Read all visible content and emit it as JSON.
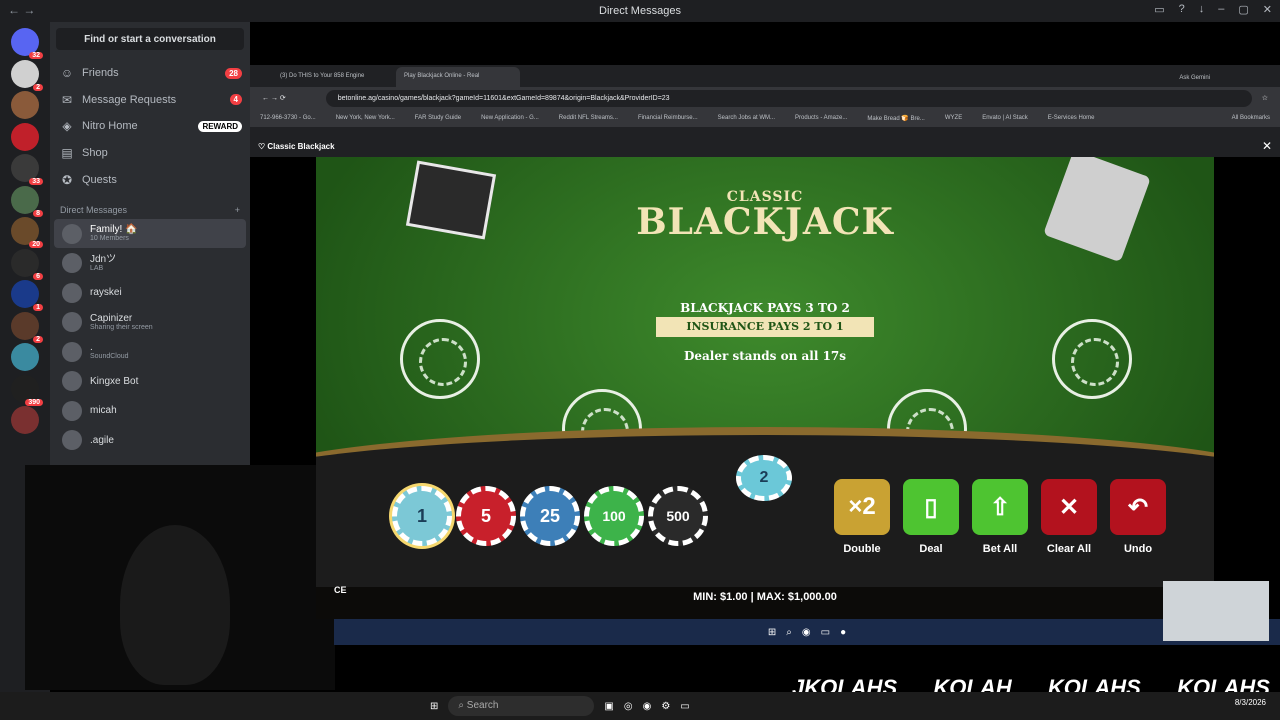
{
  "window": {
    "title": "Direct Messages"
  },
  "servers": [
    {
      "badge": "32"
    },
    {
      "badge": "2"
    },
    {
      "badge": ""
    },
    {
      "badge": ""
    },
    {
      "badge": "33"
    },
    {
      "badge": "8"
    },
    {
      "badge": "20"
    },
    {
      "badge": "6"
    },
    {
      "badge": "1"
    },
    {
      "badge": "2"
    },
    {
      "badge": ""
    },
    {
      "badge": "390"
    },
    {
      "badge": ""
    }
  ],
  "dmpanel": {
    "search": "Find or start a conversation",
    "nav": [
      {
        "label": "Friends",
        "badge": "28"
      },
      {
        "label": "Message Requests",
        "badge": "4"
      },
      {
        "label": "Nitro Home",
        "badge": "REWARD"
      },
      {
        "label": "Shop",
        "badge": ""
      },
      {
        "label": "Quests",
        "badge": ""
      }
    ],
    "header": "Direct Messages",
    "dms": [
      {
        "name": "Family! 🏠",
        "sub": "10 Members"
      },
      {
        "name": "Jdnツ",
        "sub": "LAB"
      },
      {
        "name": "rayskei",
        "sub": ""
      },
      {
        "name": "Capinizer",
        "sub": "Sharing their screen"
      },
      {
        "name": ".",
        "sub": "SoundCloud"
      },
      {
        "name": "Kingxe Bot",
        "sub": ""
      },
      {
        "name": "micah",
        "sub": ""
      },
      {
        "name": ".agile",
        "sub": ""
      }
    ]
  },
  "browser": {
    "tabs": [
      "(3) Do THIS to Your 858 Engine",
      "Play Blackjack Online - Real"
    ],
    "ask_gemini": "Ask Gemini",
    "url": "betonline.ag/casino/games/blackjack?gameId=11601&extGameId=89874&origin=Blackjack&ProviderID=23",
    "bookmarks": [
      "712-966-3730 - Go...",
      "New York, New York...",
      "FAR Study Guide",
      "New Application - G...",
      "Reddit NFL Streams...",
      "Financial Reimburse...",
      "Search Jobs at WM...",
      "Products - Amaze...",
      "Make Bread 🍞 Bre...",
      "WYZE",
      "Envato | AI Stack",
      "E-Services Home"
    ],
    "all_bookmarks": "All Bookmarks",
    "game_title": "Classic Blackjack"
  },
  "game": {
    "title_small": "CLASSIC",
    "title_big": "BLACKJACK",
    "rule1": "BLACKJACK PAYS 3 TO 2",
    "rule2": "INSURANCE PAYS 2 TO 1",
    "rule3": "Dealer stands on all 17s",
    "current_bet": "2",
    "chips": [
      {
        "value": "1",
        "color": "#7cc8d6",
        "selected": true
      },
      {
        "value": "5",
        "color": "#c8202b"
      },
      {
        "value": "25",
        "color": "#3d7fb8"
      },
      {
        "value": "100",
        "color": "#3db34a"
      },
      {
        "value": "500",
        "color": "#2a2a2a"
      }
    ],
    "buttons": [
      {
        "label": "Double",
        "icon": "×2",
        "color": "#c9a233"
      },
      {
        "label": "Deal",
        "icon": "▯",
        "color": "#4ec431"
      },
      {
        "label": "Bet All",
        "icon": "⇧",
        "color": "#4ec431"
      },
      {
        "label": "Clear All",
        "icon": "✕",
        "color": "#b3121e"
      },
      {
        "label": "Undo",
        "icon": "↶",
        "color": "#b3121e"
      }
    ],
    "limits": "MIN: $1.00 | MAX: $1,000.00",
    "balance_fragment": "CE"
  },
  "socials": [
    "JKOLAHS",
    "KOLAH",
    "KOLAHS",
    "KOLAHS"
  ],
  "taskbar": {
    "search": "Search",
    "date": "8/3/2026"
  }
}
